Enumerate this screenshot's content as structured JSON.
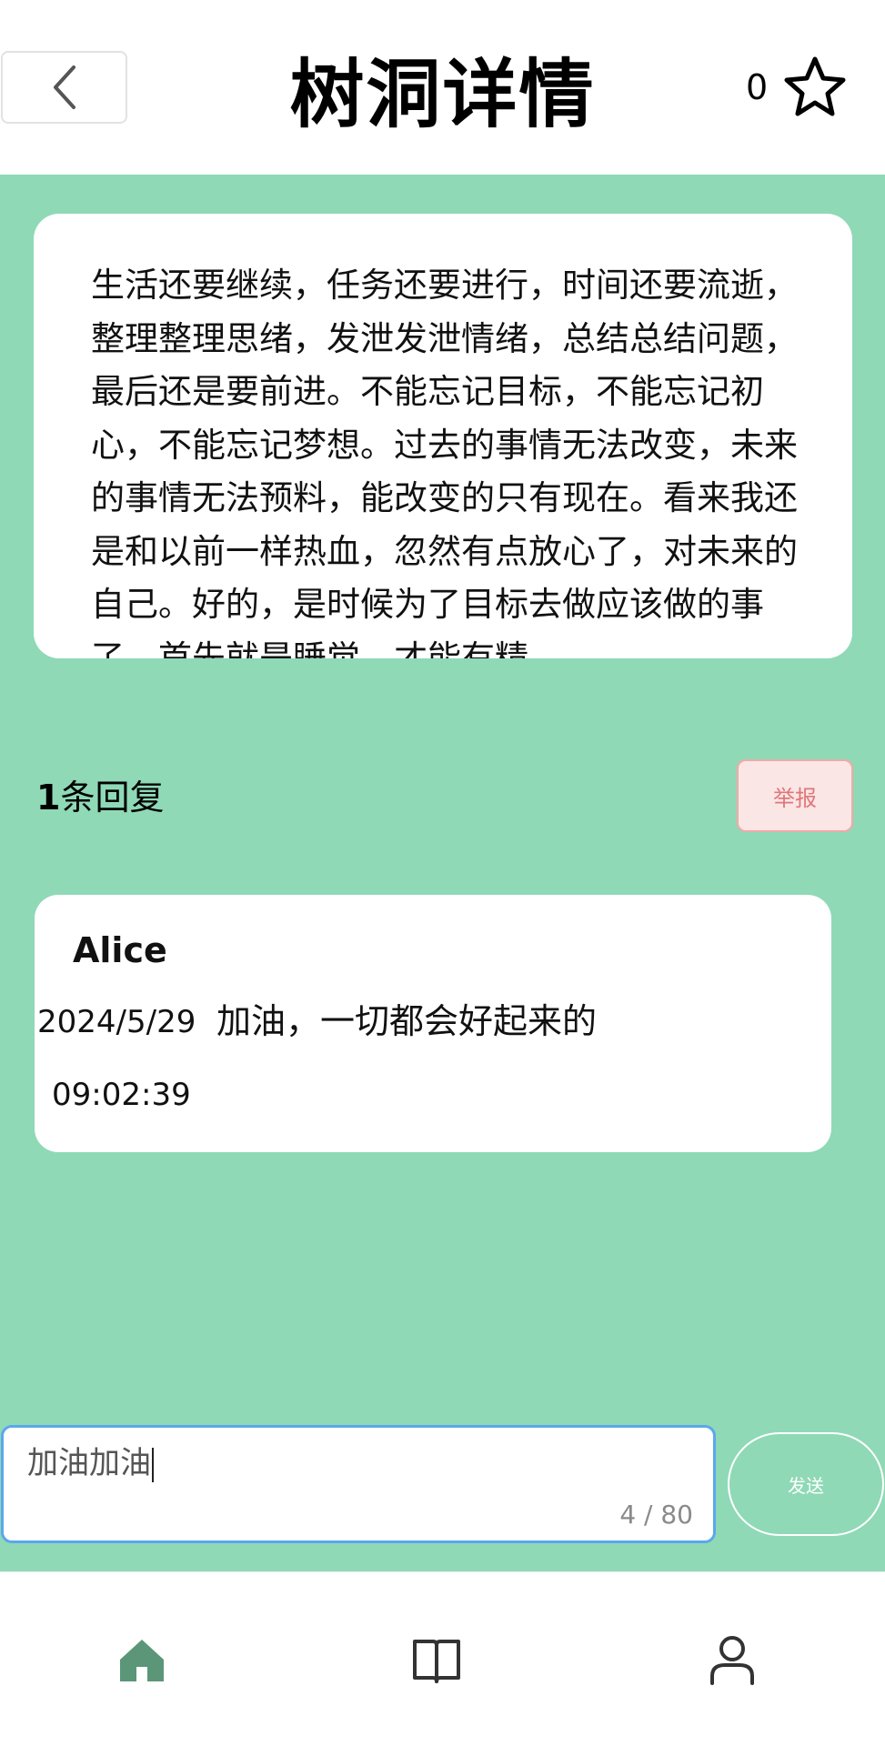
{
  "header": {
    "title": "树洞详情",
    "star_count": "0"
  },
  "post": {
    "content": "生活还要继续，任务还要进行，时间还要流逝，整理整理思绪，发泄发泄情绪，总结总结问题，最后还是要前进。不能忘记目标，不能忘记初心，不能忘记梦想。过去的事情无法改变，未来的事情无法预料，能改变的只有现在。看来我还是和以前一样热血，忽然有点放心了，对未来的自己。好的，是时候为了目标去做应该做的事了，首先就是睡觉，才能有精"
  },
  "replies": {
    "count": "1",
    "count_suffix": "条回复",
    "report_label": "举报"
  },
  "comment": {
    "author": "Alice",
    "date": "2024/5/29",
    "time": "09:02:39",
    "text": "加油，一切都会好起来的"
  },
  "composer": {
    "value": "加油加油",
    "counter": "4 / 80",
    "send_label": "发送"
  },
  "nav": {
    "items": [
      {
        "icon": "home-icon",
        "active": true
      },
      {
        "icon": "book-icon",
        "active": false
      },
      {
        "icon": "user-icon",
        "active": false
      }
    ]
  },
  "colors": {
    "background_green": "#8fd9b6",
    "home_active": "#5b9678",
    "report_text": "#e0777a",
    "input_border": "#5aa8ea"
  }
}
